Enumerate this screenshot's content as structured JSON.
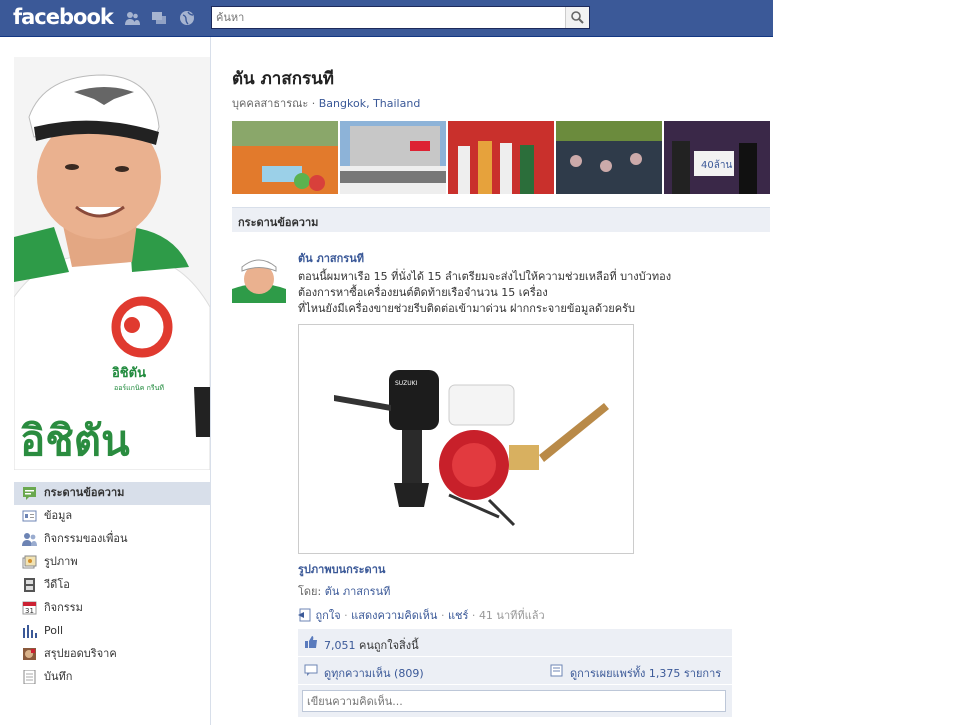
{
  "topbar": {
    "logo": "facebook",
    "search_placeholder": "ค้นหา"
  },
  "profile": {
    "name": "ตัน ภาสกรนที",
    "category": "บุคคลสาธารณะ",
    "separator": " · ",
    "location": "Bangkok, Thailand",
    "brand_text": "อิชิตัน",
    "brand_small": "อิชิตัน",
    "brand_sub": "ออร์แกนิค กรีนที"
  },
  "leftnav": {
    "items": [
      {
        "label": "กระดานข้อความ",
        "icon": "wall-icon",
        "active": true
      },
      {
        "label": "ข้อมูล",
        "icon": "info-icon"
      },
      {
        "label": "กิจกรรมของเพื่อน",
        "icon": "friends-icon"
      },
      {
        "label": "รูปภาพ",
        "icon": "photos-icon"
      },
      {
        "label": "วีดีโอ",
        "icon": "video-icon"
      },
      {
        "label": "กิจกรรม",
        "icon": "calendar-icon",
        "calendar_day": "31"
      },
      {
        "label": "Poll",
        "icon": "poll-icon"
      },
      {
        "label": "สรุปยอดบริจาค",
        "icon": "donation-icon"
      },
      {
        "label": "บันทึก",
        "icon": "notes-icon"
      }
    ]
  },
  "wall": {
    "tab_label": "กระดานข้อความ"
  },
  "post": {
    "author": "ตัน ภาสกรนที",
    "text_lines": [
      "ตอนนี้ผมหาเรือ 15 ที่นั่งได้ 15 ลำเตรียมจะส่งไปให้ความช่วยเหลือที่ บางบัวทอง",
      "ต้องการหาซื้อเครื่องยนต์ติดท้ายเรือจำนวน 15 เครื่อง",
      "ที่ไหนยังมีเครื่องขายช่วยรีบติดต่อเข้ามาด่วน ฝากกระจายข้อมูลด้วยครับ"
    ],
    "attachment_title": "รูปภาพบนกระดาน",
    "by_label": "โดย: ",
    "by_name": "ตัน ภาสกรนที",
    "motor_brand": "SUZUKI",
    "actions": {
      "like": "ถูกใจ",
      "comment": "แสดงความคิดเห็น",
      "share": "แชร์",
      "time": "41 นาทีที่แล้ว"
    },
    "likes_count": "7,051",
    "likes_text": " คนถูกใจสิ่งนี้",
    "view_comments": "ดูทุกความเห็น (809)",
    "view_shares": "ดูการเผยแพร่ทั้ง 1,375 รายการ",
    "comment_placeholder": "เขียนความคิดเห็น..."
  },
  "photo_strip": {
    "badge_text": "40ล้าน"
  },
  "colors": {
    "brand_blue": "#3b5998",
    "nav_active": "#d8dfea",
    "ufi_bg": "#eceff5",
    "green": "#1f8a3c",
    "red": "#e03a2f"
  }
}
